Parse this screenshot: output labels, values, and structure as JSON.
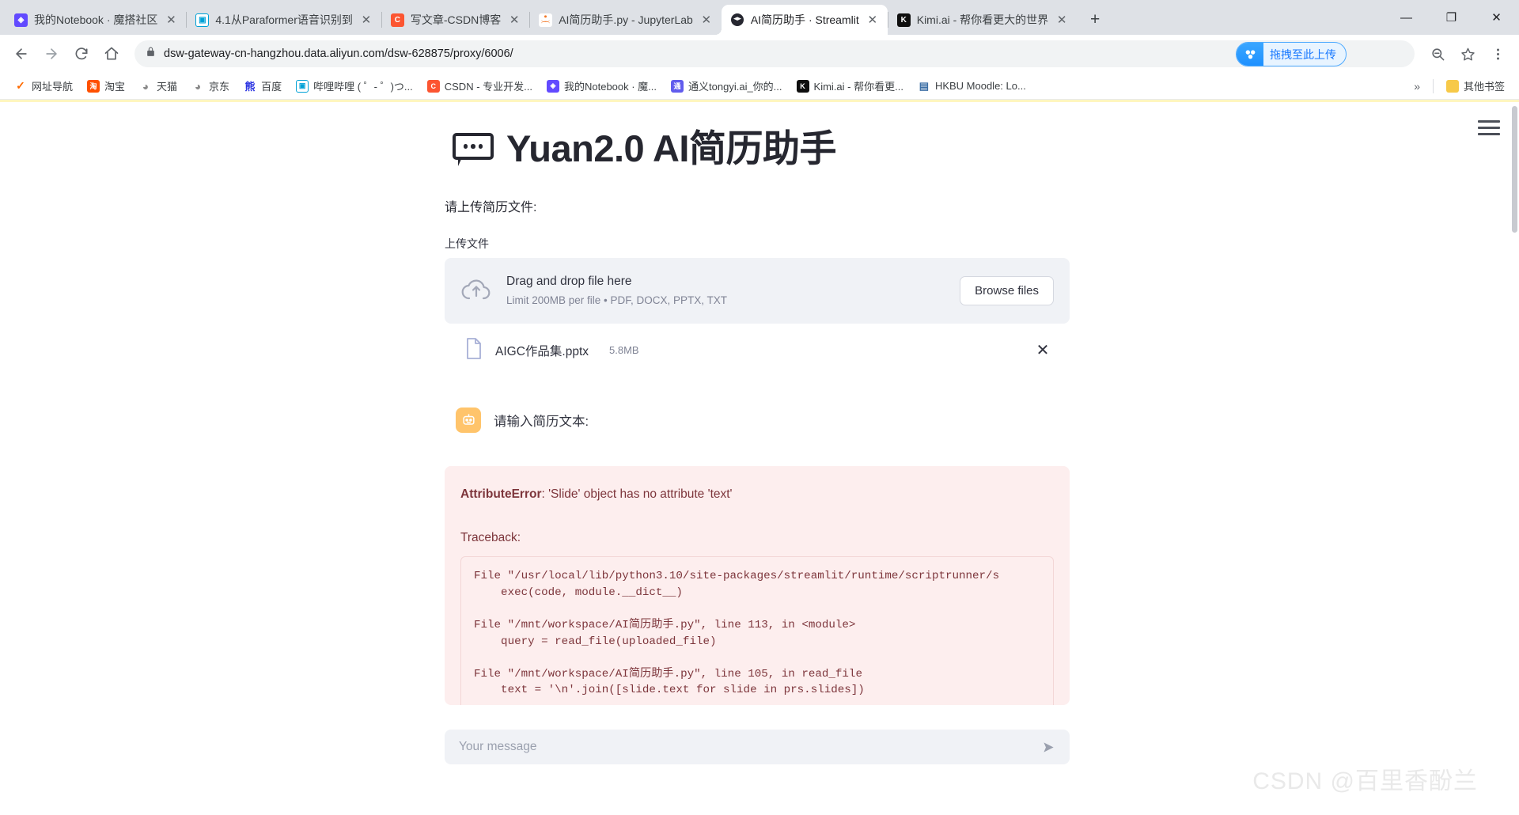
{
  "browser": {
    "tabs": [
      {
        "title": "我的Notebook · 魔搭社区",
        "favicon": "modelscope-icon",
        "active": false
      },
      {
        "title": "4.1从Paraformer语音识别到",
        "favicon": "bilibili-icon",
        "active": false
      },
      {
        "title": "写文章-CSDN博客",
        "favicon": "csdn-icon",
        "active": false
      },
      {
        "title": "AI简历助手.py - JupyterLab",
        "favicon": "jupyter-icon",
        "active": false
      },
      {
        "title": "AI简历助手 · Streamlit",
        "favicon": "streamlit-icon",
        "active": true
      },
      {
        "title": "Kimi.ai - 帮你看更大的世界",
        "favicon": "kimi-icon",
        "active": false
      }
    ],
    "new_tab_label": "+",
    "window_controls": {
      "minimize": "—",
      "maximize": "❐",
      "close": "✕"
    },
    "nav": {
      "back": "←",
      "forward": "→",
      "reload": "⟳",
      "home": "⌂"
    },
    "omnibox": {
      "url": "dsw-gateway-cn-hangzhou.data.aliyun.com/dsw-628875/proxy/6006/",
      "lock_icon": "lock-icon",
      "zoom_icon": "zoom-out-icon",
      "bookmark_icon": "star-icon",
      "menu_icon": "kebab-menu-icon"
    },
    "aliyun_pill": {
      "label": "拖拽至此上传",
      "icon": "aliyun-drive-icon"
    },
    "bookmarks": [
      {
        "label": "网址导航",
        "icon": "hao123-icon",
        "cls": "i-hao",
        "glyph": "✓"
      },
      {
        "label": "淘宝",
        "icon": "taobao-icon",
        "cls": "i-taobao",
        "glyph": "淘"
      },
      {
        "label": "天猫",
        "icon": "tmall-icon",
        "cls": "i-tmall",
        "glyph": "◕"
      },
      {
        "label": "京东",
        "icon": "jd-icon",
        "cls": "i-jd",
        "glyph": "◕"
      },
      {
        "label": "百度",
        "icon": "baidu-icon",
        "cls": "i-baidu",
        "glyph": "熊"
      },
      {
        "label": "哔哩哔哩 ( ゜- ゜)つ...",
        "icon": "bilibili-icon",
        "cls": "i-bili",
        "glyph": "▣"
      },
      {
        "label": "CSDN - 专业开发...",
        "icon": "csdn-icon",
        "cls": "i-csdn",
        "glyph": "C"
      },
      {
        "label": "我的Notebook · 魔...",
        "icon": "modelscope-icon",
        "cls": "i-ms",
        "glyph": "◈"
      },
      {
        "label": "通义tongyi.ai_你的...",
        "icon": "tongyi-icon",
        "cls": "i-tongyi",
        "glyph": "通"
      },
      {
        "label": "Kimi.ai - 帮你看更...",
        "icon": "kimi-icon",
        "cls": "i-kimi",
        "glyph": "K"
      },
      {
        "label": "HKBU Moodle: Lo...",
        "icon": "moodle-icon",
        "cls": "i-moodle",
        "glyph": "▤"
      }
    ],
    "bookmarks_overflow": "»",
    "other_bookmarks": {
      "label": "其他书签",
      "icon": "folder-icon"
    }
  },
  "app": {
    "title": "Yuan2.0 AI简历助手",
    "title_icon": "speech-bubble-icon",
    "hamburger_icon": "hamburger-menu-icon",
    "upload_prompt": "请上传简历文件:",
    "uploader": {
      "section_label": "上传文件",
      "drag_text": "Drag and drop file here",
      "limit_text": "Limit 200MB per file • PDF, DOCX, PPTX, TXT",
      "browse_label": "Browse files",
      "cloud_icon": "cloud-upload-icon"
    },
    "uploaded_file": {
      "name": "AIGC作品集.pptx",
      "size": "5.8MB",
      "file_icon": "document-icon",
      "remove_icon": "close-icon"
    },
    "chat_message": {
      "avatar_icon": "robot-avatar-icon",
      "text": "请输入简历文本:"
    },
    "error": {
      "type": "AttributeError",
      "message": ": 'Slide' object has no attribute 'text'",
      "traceback_label": "Traceback:",
      "traceback": "File \"/usr/local/lib/python3.10/site-packages/streamlit/runtime/scriptrunner/s\n    exec(code, module.__dict__)\n\nFile \"/mnt/workspace/AI简历助手.py\", line 113, in <module>\n    query = read_file(uploaded_file)\n\nFile \"/mnt/workspace/AI简历助手.py\", line 105, in read_file\n    text = '\\n'.join([slide.text for slide in prs.slides])"
    },
    "chat_input": {
      "placeholder": "Your message",
      "value": "",
      "send_icon": "send-arrow-icon"
    }
  },
  "watermark": "CSDN @百里香酚兰"
}
